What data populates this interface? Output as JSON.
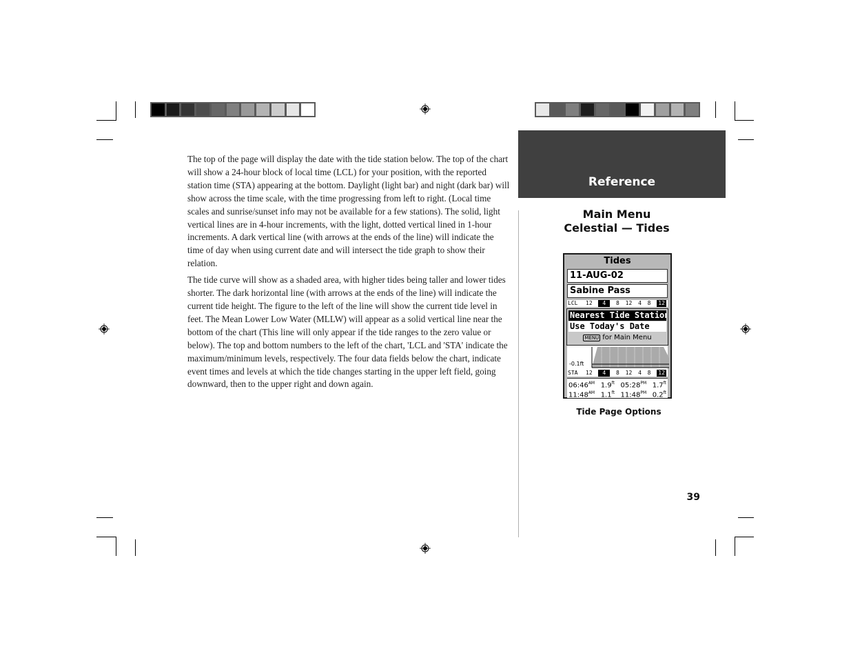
{
  "body": {
    "paragraphs": [
      "The top of the page will display the date with the tide station below.  The top of the chart will show a 24-hour block of local time (LCL) for your position, with the reported station time (STA) appearing at the bottom.  Daylight (light bar) and night (dark bar) will show across the time scale, with the time progressing from left to right.  (Local time scales and sunrise/sunset info may not be available for a few stations).  The solid, light vertical lines are in 4-hour increments, with the light, dotted vertical lined in 1-hour increments.  A dark vertical line (with arrows at the ends of the line) will indicate the time of day when using current date and will intersect the tide graph to show their relation.",
      "The tide curve will show as a shaded area, with higher tides being taller and lower tides shorter.  The dark horizontal line (with arrows at the ends of the line) will indicate the current tide height.  The figure to the left of the line will show the current tide level in feet.  The Mean Lower Low Water (MLLW) will appear as a solid vertical line near the bottom of the chart (This line will only appear if the tide ranges to the zero value or below).  The top and bottom numbers to the left of the chart, 'LCL and 'STA' indicate the maximum/minimum levels, respectively.  The four data fields below the chart, indicate event times and levels at which the tide changes starting in the upper left field, going downward, then to the upper right and down again."
    ]
  },
  "sidebar": {
    "section_title": "Reference",
    "heading_line1": "Main Menu",
    "heading_line2": "Celestial — Tides",
    "caption": "Tide Page Options",
    "page_number": "39"
  },
  "colors": {
    "left_swatches": [
      "#000000",
      "#1a1a1a",
      "#333333",
      "#4d4d4d",
      "#666666",
      "#808080",
      "#999999",
      "#b3b3b3",
      "#cccccc",
      "#e6e6e6",
      "#ffffff"
    ],
    "right_swatches": [
      "#e8e8e8",
      "#595959",
      "#7f7f7f",
      "#1e1e1e",
      "#666666",
      "#595959",
      "#000000",
      "#f2f2f2",
      "#9f9f9f",
      "#b3b3b3",
      "#7f7f7f"
    ],
    "section_bg": "#404040"
  },
  "device": {
    "title": "Tides",
    "date": "11-AUG-02",
    "station": "Sabine Pass",
    "lcl_label": "LCL",
    "sta_label": "STA",
    "scale_ticks": [
      "12",
      "4",
      "8",
      "12",
      "4",
      "8",
      "12"
    ],
    "menu_options": [
      {
        "label": "Nearest Tide Station",
        "selected": true
      },
      {
        "label": "Use Today's Date",
        "selected": false
      }
    ],
    "menu_key": "MENU",
    "menu_hint": "for Main Menu",
    "min_level": "-0.1ft",
    "events": [
      {
        "time": "06:46",
        "ampm": "AM",
        "level": "1.9",
        "unit": "ft"
      },
      {
        "time": "11:48",
        "ampm": "AM",
        "level": "1.1",
        "unit": "ft"
      },
      {
        "time": "05:28",
        "ampm": "PM",
        "level": "1.7",
        "unit": "ft"
      },
      {
        "time": "11:48",
        "ampm": "PM",
        "level": "0.2",
        "unit": "ft"
      }
    ]
  }
}
